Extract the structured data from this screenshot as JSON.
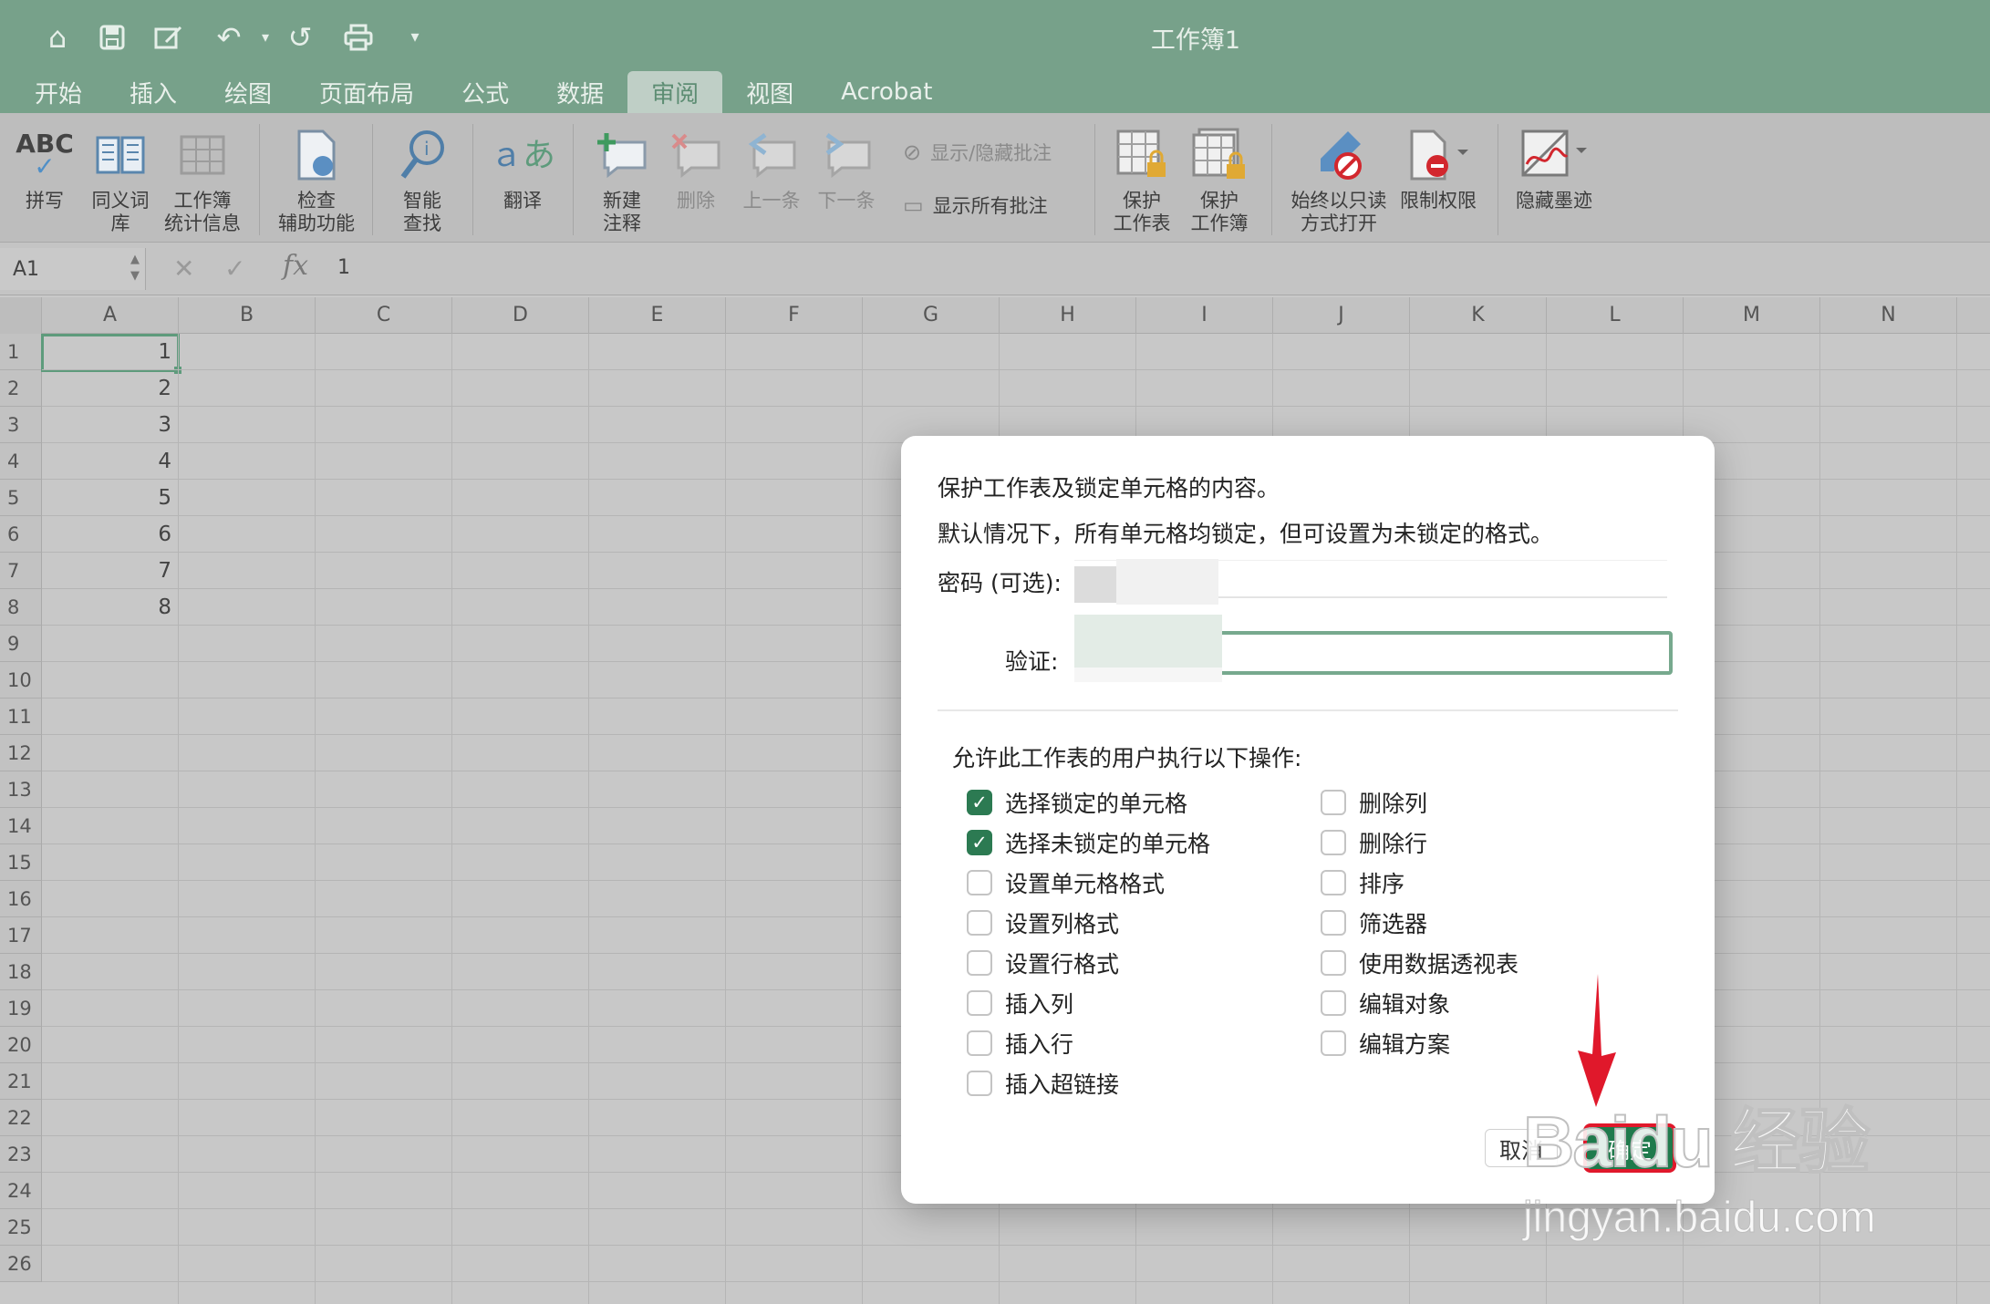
{
  "window": {
    "title": "工作簿1"
  },
  "quick_access": [
    "home-icon",
    "save-icon",
    "edit-icon",
    "undo-icon",
    "redo-icon",
    "print-icon",
    "customize-icon"
  ],
  "tabs": [
    "开始",
    "插入",
    "绘图",
    "页面布局",
    "公式",
    "数据",
    "审阅",
    "视图",
    "Acrobat"
  ],
  "active_tab": "审阅",
  "ribbon": {
    "spelling": "拼写",
    "thesaurus": [
      "同义词",
      "库"
    ],
    "workbook_stats": [
      "工作簿",
      "统计信息"
    ],
    "check_accessibility": [
      "检查",
      "辅助功能"
    ],
    "smart_lookup": [
      "智能",
      "查找"
    ],
    "translate": "翻译",
    "new_comment": [
      "新建",
      "注释"
    ],
    "delete": "删除",
    "previous": "上一条",
    "next": "下一条",
    "show_hide_comments": "显示/隐藏批注",
    "show_all_comments": "显示所有批注",
    "protect_sheet": [
      "保护",
      "工作表"
    ],
    "protect_workbook": [
      "保护",
      "工作簿"
    ],
    "always_open_readonly": [
      "始终以只读",
      "方式打开"
    ],
    "restrict_permission": "限制权限",
    "hide_ink": "隐藏墨迹"
  },
  "formula_bar": {
    "name_box": "A1",
    "fx": "fx",
    "value": "1"
  },
  "columns": [
    "A",
    "B",
    "C",
    "D",
    "E",
    "F",
    "G",
    "H",
    "I",
    "J",
    "K",
    "L",
    "M",
    "N"
  ],
  "rows": [
    "1",
    "2",
    "3",
    "4",
    "5",
    "6",
    "7",
    "8",
    "9",
    "10",
    "11",
    "12",
    "13",
    "14",
    "15",
    "16",
    "17",
    "18",
    "19",
    "20",
    "21",
    "22",
    "23",
    "24",
    "25",
    "26"
  ],
  "column_a_values": [
    "1",
    "2",
    "3",
    "4",
    "5",
    "6",
    "7",
    "8"
  ],
  "dialog": {
    "heading": "保护工作表及锁定单元格的内容。",
    "description": "默认情况下，所有单元格均锁定，但可设置为未锁定的格式。",
    "password_label": "密码 (可选):",
    "verify_label": "验证:",
    "allow_label": "允许此工作表的用户执行以下操作:",
    "options_left": [
      {
        "label": "选择锁定的单元格",
        "checked": true
      },
      {
        "label": "选择未锁定的单元格",
        "checked": true
      },
      {
        "label": "设置单元格格式",
        "checked": false
      },
      {
        "label": "设置列格式",
        "checked": false
      },
      {
        "label": "设置行格式",
        "checked": false
      },
      {
        "label": "插入列",
        "checked": false
      },
      {
        "label": "插入行",
        "checked": false
      },
      {
        "label": "插入超链接",
        "checked": false
      }
    ],
    "options_right": [
      {
        "label": "删除列",
        "checked": false
      },
      {
        "label": "删除行",
        "checked": false
      },
      {
        "label": "排序",
        "checked": false
      },
      {
        "label": "筛选器",
        "checked": false
      },
      {
        "label": "使用数据透视表",
        "checked": false
      },
      {
        "label": "编辑对象",
        "checked": false
      },
      {
        "label": "编辑方案",
        "checked": false
      }
    ],
    "cancel": "取消",
    "ok": "确定"
  },
  "watermark": {
    "logo": "Baidu 经验",
    "url": "jingyan.baidu.com"
  },
  "colors": {
    "accent": "#77a18a",
    "ok_button": "#1f7a4c",
    "highlight": "#e0182b"
  }
}
